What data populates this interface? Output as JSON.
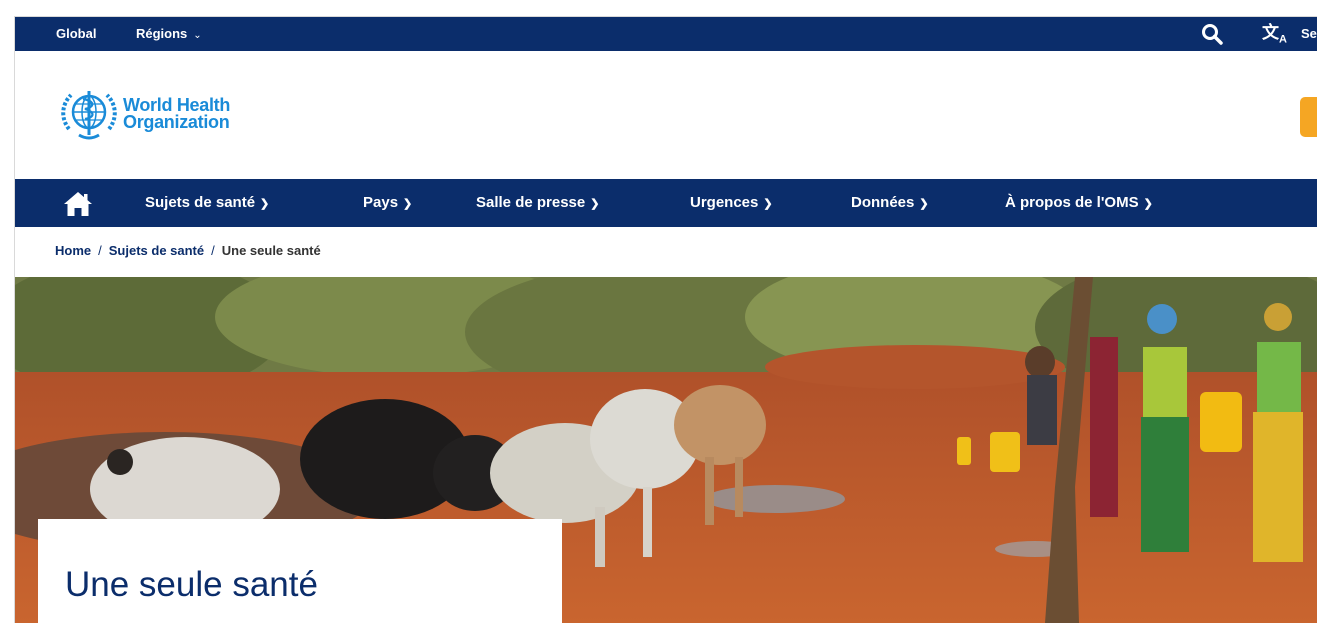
{
  "topbar": {
    "global_label": "Global",
    "regions_label": "Régions",
    "select_label": "Se",
    "icons": {
      "search": "search-icon",
      "translate": "translate-icon"
    }
  },
  "header": {
    "logo_line1": "World Health",
    "logo_line2": "Organization"
  },
  "nav": {
    "items": [
      {
        "label": "Sujets de santé"
      },
      {
        "label": "Pays"
      },
      {
        "label": "Salle de presse"
      },
      {
        "label": "Urgences"
      },
      {
        "label": "Données"
      },
      {
        "label": "À propos de l'OMS"
      }
    ]
  },
  "breadcrumb": {
    "home": "Home",
    "separator": "/",
    "parent": "Sujets de santé",
    "current": "Une seule santé"
  },
  "hero": {
    "title": "Une seule santé"
  },
  "colors": {
    "brand_navy": "#0b2d6b",
    "logo_blue": "#1a8bd8",
    "donate_orange": "#f5a623"
  }
}
